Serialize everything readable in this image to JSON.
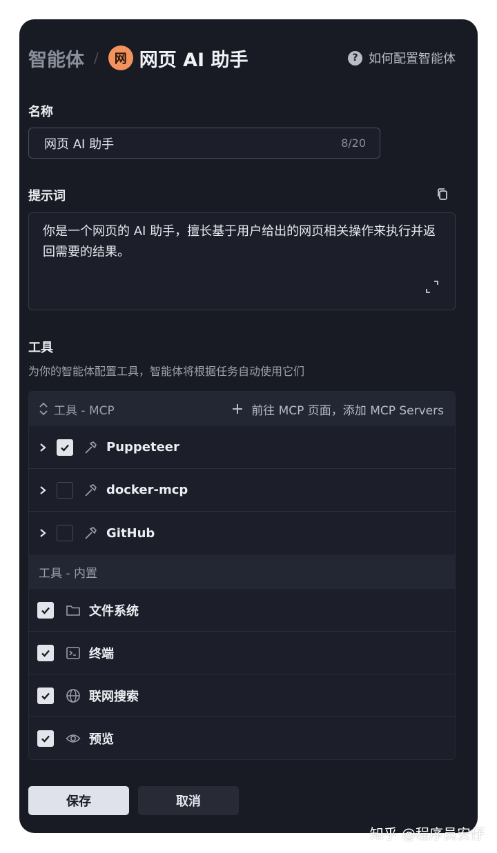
{
  "header": {
    "root": "智能体",
    "separator": "/",
    "app_badge": "网",
    "title": "网页 AI 助手",
    "help_label": "如何配置智能体",
    "help_glyph": "?"
  },
  "name": {
    "label": "名称",
    "value": "网页 AI 助手",
    "count": "8/20"
  },
  "prompt": {
    "label": "提示词",
    "text": "你是一个网页的 AI 助手，擅长基于用户给出的网页相关操作来执行并返回需要的结果。"
  },
  "tools": {
    "label": "工具",
    "description": "为你的智能体配置工具，智能体将根据任务自动使用它们",
    "mcp": {
      "title": "工具 - MCP",
      "add_link": "前往 MCP 页面，添加 MCP Servers",
      "items": [
        {
          "name": "Puppeteer",
          "checked": true
        },
        {
          "name": "docker-mcp",
          "checked": false
        },
        {
          "name": "GitHub",
          "checked": false
        }
      ]
    },
    "builtin": {
      "title": "工具 - 内置",
      "items": [
        {
          "name": "文件系统",
          "icon": "folder-icon",
          "checked": true
        },
        {
          "name": "终端",
          "icon": "terminal-icon",
          "checked": true
        },
        {
          "name": "联网搜索",
          "icon": "globe-icon",
          "checked": true
        },
        {
          "name": "预览",
          "icon": "eye-icon",
          "checked": true
        }
      ]
    }
  },
  "actions": {
    "save": "保存",
    "cancel": "取消"
  },
  "watermark": "知乎 @程序员安仔",
  "colors": {
    "panel_bg": "#181b24",
    "badge": "#f2935e",
    "save_bg": "#dfe2ea",
    "cancel_bg": "#282b36"
  }
}
